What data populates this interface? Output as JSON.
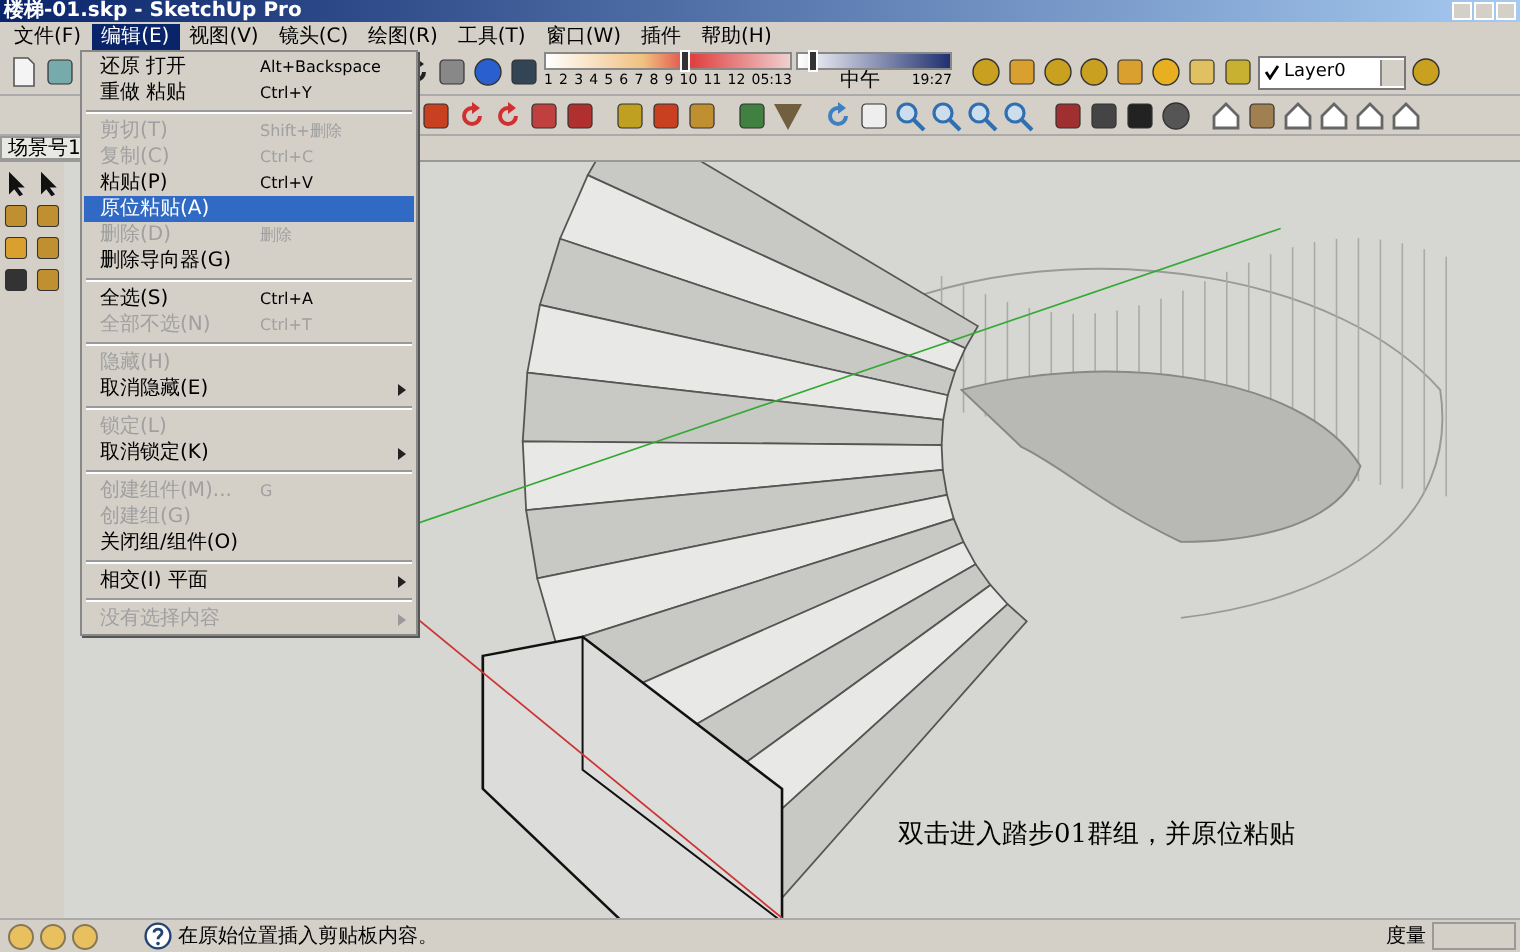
{
  "window": {
    "title": "楼梯-01.skp - SketchUp Pro"
  },
  "menu_bar": [
    {
      "label": "文件(F)",
      "selected": false
    },
    {
      "label": "编辑(E)",
      "selected": true
    },
    {
      "label": "视图(V)",
      "selected": false
    },
    {
      "label": "镜头(C)",
      "selected": false
    },
    {
      "label": "绘图(R)",
      "selected": false
    },
    {
      "label": "工具(T)",
      "selected": false
    },
    {
      "label": "窗口(W)",
      "selected": false
    },
    {
      "label": "插件",
      "selected": false
    },
    {
      "label": "帮助(H)",
      "selected": false
    }
  ],
  "shadow_bar": {
    "date_slider": {
      "level": 0.55
    },
    "time_slider": {
      "level": 0.06
    },
    "months": [
      "1",
      "2",
      "3",
      "4",
      "5",
      "6",
      "7",
      "8",
      "9",
      "10",
      "11",
      "12"
    ],
    "time_start": "05:13",
    "noon": "中午",
    "time_end": "19:27"
  },
  "layer_dropdown": {
    "checked": true,
    "value": "Layer0"
  },
  "scene_tab": {
    "label": "场景号1"
  },
  "edit_menu": [
    {
      "kind": "item",
      "label": "还原 打开",
      "shortcut": "Alt+Backspace",
      "disabled": false,
      "selected": false,
      "submenu": false
    },
    {
      "kind": "item",
      "label": "重做 粘贴",
      "shortcut": "Ctrl+Y",
      "disabled": false,
      "selected": false,
      "submenu": false
    },
    {
      "kind": "separator"
    },
    {
      "kind": "item",
      "label": "剪切(T)",
      "shortcut": "Shift+删除",
      "disabled": true,
      "selected": false,
      "submenu": false
    },
    {
      "kind": "item",
      "label": "复制(C)",
      "shortcut": "Ctrl+C",
      "disabled": true,
      "selected": false,
      "submenu": false
    },
    {
      "kind": "item",
      "label": "粘贴(P)",
      "shortcut": "Ctrl+V",
      "disabled": false,
      "selected": false,
      "submenu": false
    },
    {
      "kind": "item",
      "label": "原位粘贴(A)",
      "disabled": false,
      "selected": true,
      "submenu": false
    },
    {
      "kind": "item",
      "label": "删除(D)",
      "shortcut": "删除",
      "disabled": true,
      "selected": false,
      "submenu": false
    },
    {
      "kind": "item",
      "label": "删除导向器(G)",
      "disabled": false,
      "selected": false,
      "submenu": false
    },
    {
      "kind": "separator"
    },
    {
      "kind": "item",
      "label": "全选(S)",
      "shortcut": "Ctrl+A",
      "disabled": false,
      "selected": false,
      "submenu": false
    },
    {
      "kind": "item",
      "label": "全部不选(N)",
      "shortcut": "Ctrl+T",
      "disabled": true,
      "selected": false,
      "submenu": false
    },
    {
      "kind": "separator"
    },
    {
      "kind": "item",
      "label": "隐藏(H)",
      "disabled": true,
      "selected": false,
      "submenu": false
    },
    {
      "kind": "item",
      "label": "取消隐藏(E)",
      "disabled": false,
      "selected": false,
      "submenu": true
    },
    {
      "kind": "separator"
    },
    {
      "kind": "item",
      "label": "锁定(L)",
      "disabled": true,
      "selected": false,
      "submenu": false
    },
    {
      "kind": "item",
      "label": "取消锁定(K)",
      "disabled": false,
      "selected": false,
      "submenu": true
    },
    {
      "kind": "separator"
    },
    {
      "kind": "item",
      "label": "创建组件(M)...",
      "shortcut": "G",
      "disabled": true,
      "selected": false,
      "submenu": false
    },
    {
      "kind": "item",
      "label": "创建组(G)",
      "disabled": true,
      "selected": false,
      "submenu": false
    },
    {
      "kind": "item",
      "label": "关闭组/组件(O)",
      "disabled": false,
      "selected": false,
      "submenu": false
    },
    {
      "kind": "separator"
    },
    {
      "kind": "item",
      "label": "相交(I) 平面",
      "disabled": false,
      "selected": false,
      "submenu": true
    },
    {
      "kind": "separator"
    },
    {
      "kind": "item",
      "label": "没有选择内容",
      "disabled": true,
      "selected": false,
      "submenu": true
    }
  ],
  "caption": "双击进入踏步01群组，并原位粘贴",
  "status_bar": {
    "message": "在原始位置插入剪贴板内容。",
    "measure_label": "度量"
  }
}
